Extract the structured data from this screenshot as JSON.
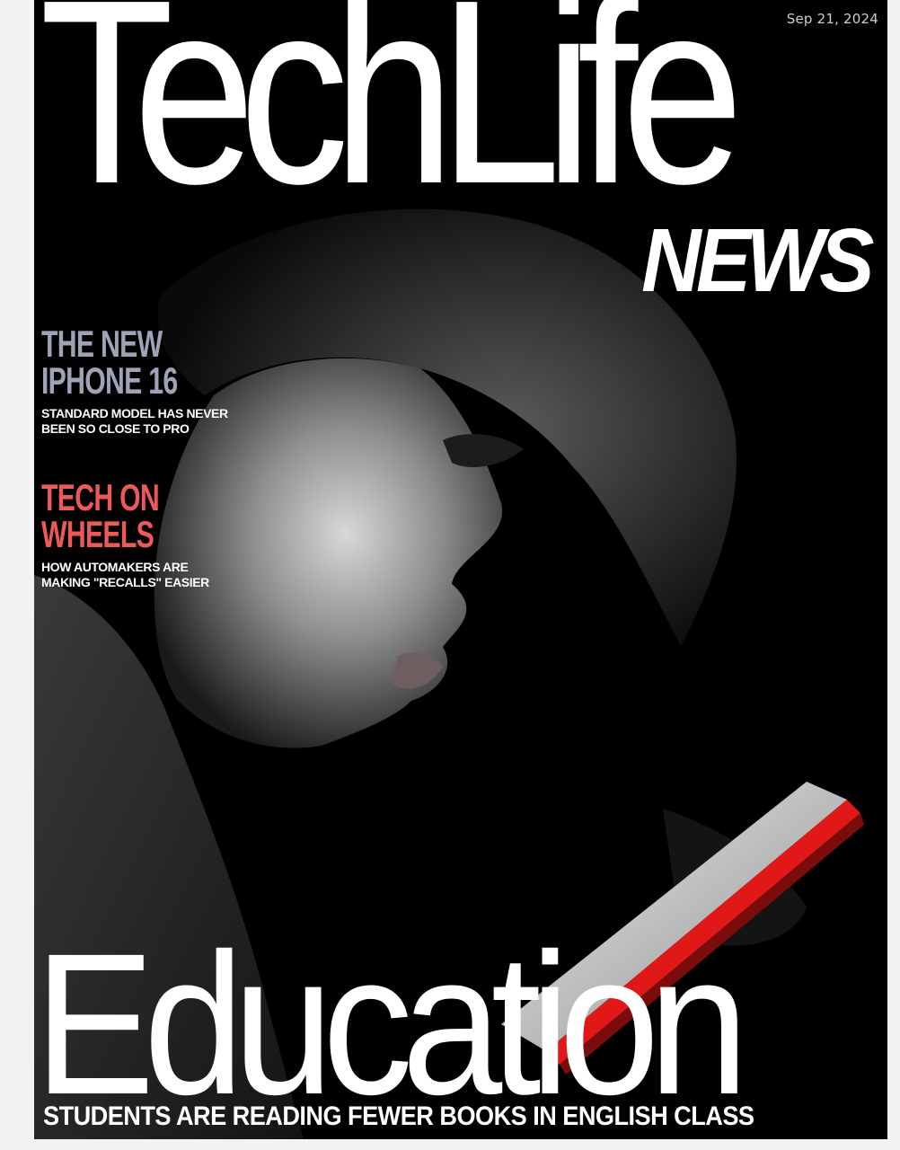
{
  "cover": {
    "date": "Sep 21, 2024",
    "masthead_title": "TechLife",
    "masthead_subtitle": "NEWS",
    "stories": [
      {
        "headline": "THE NEW\nIPHONE 16",
        "subline": "STANDARD MODEL HAS NEVER\nBEEN SO CLOSE TO PRO",
        "color": "#9ea3b8"
      },
      {
        "headline": "TECH ON\nWHEELS",
        "subline": "HOW AUTOMAKERS ARE\nMAKING \"RECALLS\" EASIER",
        "color": "#ec5a57"
      }
    ],
    "feature_title": "Education",
    "feature_subtitle": "STUDENTS ARE READING FEWER BOOKS IN ENGLISH CLASS"
  },
  "colors": {
    "background": "#000000",
    "masthead": "#ffffff",
    "story1_headline": "#9ea3b8",
    "story2_headline": "#ec5a57",
    "tablet_glow": "#e01818"
  }
}
